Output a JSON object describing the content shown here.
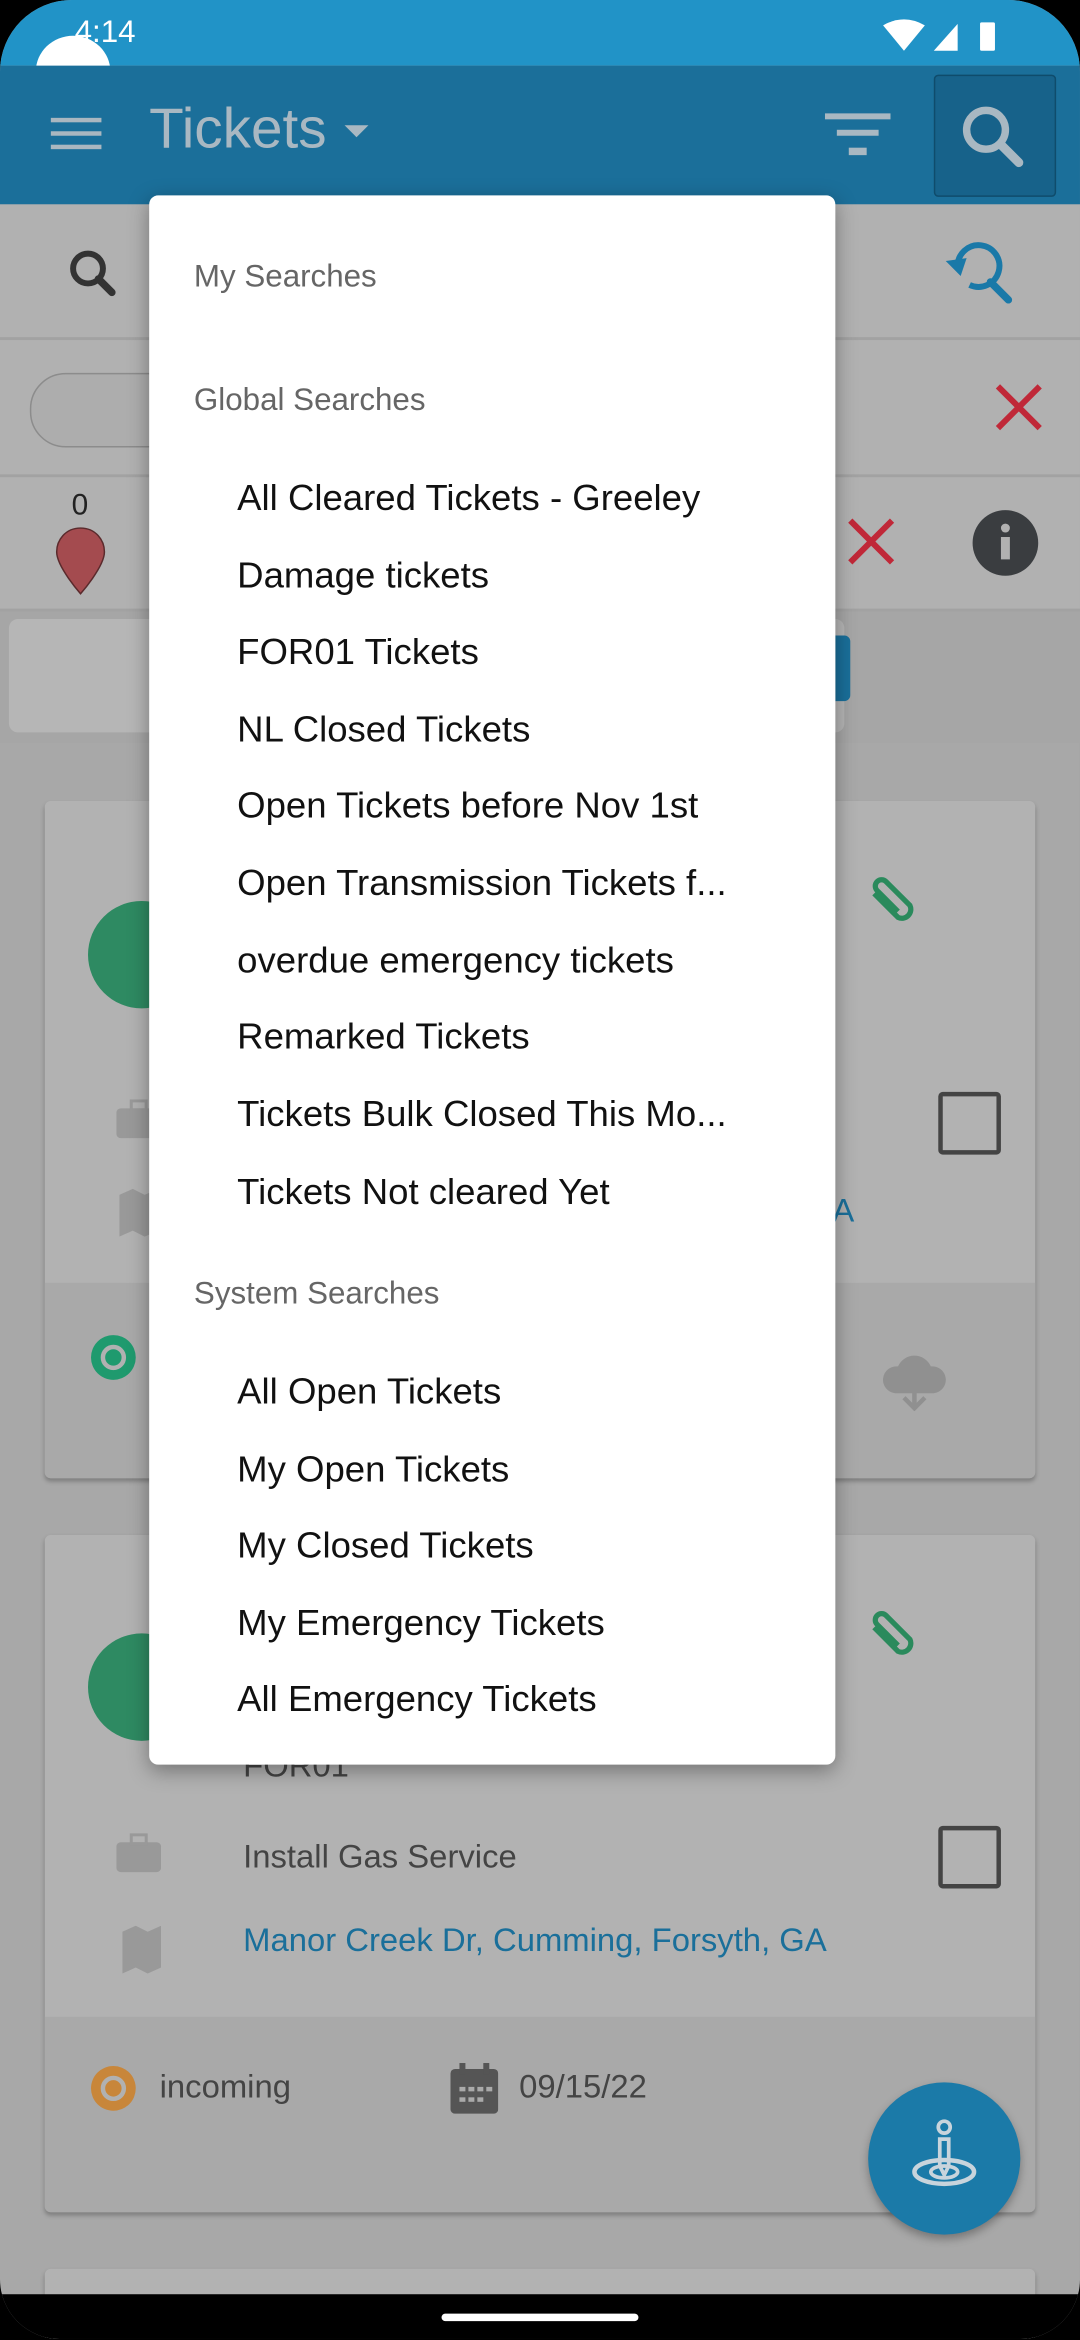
{
  "status_bar": {
    "time": "4:14"
  },
  "app_bar": {
    "title": "Tickets"
  },
  "filter_bar": {
    "count": "0"
  },
  "menu": {
    "my_searches_header": "My Searches",
    "global_searches_header": "Global Searches",
    "global_items": [
      "All Cleared Tickets - Greeley",
      "Damage tickets",
      "FOR01 Tickets",
      "NL Closed Tickets",
      "Open Tickets before Nov 1st",
      "Open Transmission Tickets f...",
      "overdue emergency tickets",
      "Remarked Tickets",
      "Tickets Bulk Closed This Mo...",
      "Tickets Not cleared Yet"
    ],
    "system_searches_header": "System Searches",
    "system_items": [
      "All Open Tickets",
      "My Open Tickets",
      "My Closed Tickets",
      "My Emergency Tickets",
      "All Emergency Tickets"
    ]
  },
  "cards": [
    {
      "address_fragment": "A"
    },
    {
      "code": "FOR01",
      "work_type": "Install Gas Service",
      "address": "Manor Creek Dr, Cumming, Forsyth, GA",
      "status": "incoming",
      "date": "09/15/22"
    }
  ],
  "colors": {
    "accent": "#2196c8",
    "status_incoming": "#c8863a",
    "status_other": "#1f9a6e",
    "danger": "#c8283a"
  }
}
